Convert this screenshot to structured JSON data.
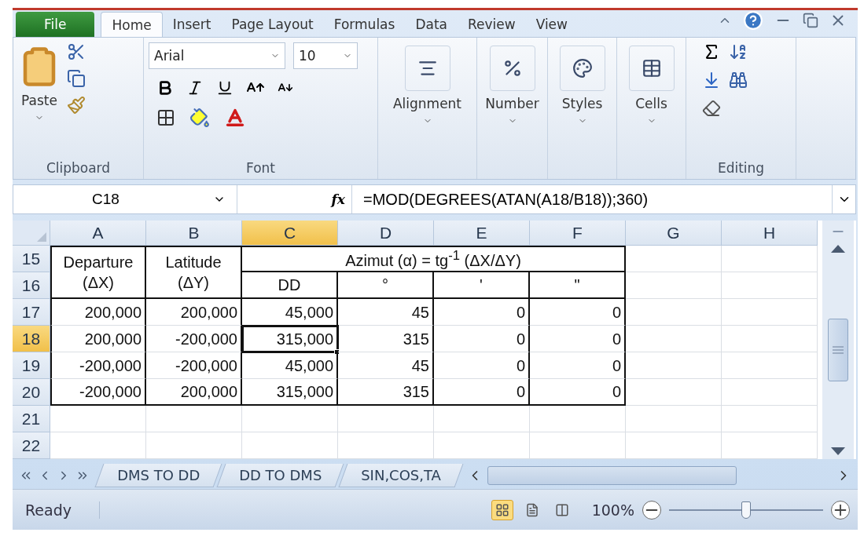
{
  "ribbon_tabs": [
    {
      "label": "File",
      "kind": "file",
      "selected": false
    },
    {
      "label": "Home",
      "kind": "tab",
      "selected": true
    },
    {
      "label": "Insert",
      "kind": "tab",
      "selected": false
    },
    {
      "label": "Page Layout",
      "kind": "tab",
      "selected": false
    },
    {
      "label": "Formulas",
      "kind": "tab",
      "selected": false
    },
    {
      "label": "Data",
      "kind": "tab",
      "selected": false
    },
    {
      "label": "Review",
      "kind": "tab",
      "selected": false
    },
    {
      "label": "View",
      "kind": "tab",
      "selected": false
    }
  ],
  "ribbon": {
    "paste_label": "Paste",
    "clipboard_label": "Clipboard",
    "font_name": "Arial",
    "font_size": "10",
    "font_label": "Font",
    "alignment_label": "Alignment",
    "number_label": "Number",
    "styles_label": "Styles",
    "cells_label": "Cells",
    "editing_label": "Editing"
  },
  "formula_bar": {
    "name_box": "C18",
    "function_label": "fx",
    "formula": "=MOD(DEGREES(ATAN(A18/B18));360)"
  },
  "sheet": {
    "columns": [
      {
        "label": "A",
        "selected": false
      },
      {
        "label": "B",
        "selected": false
      },
      {
        "label": "C",
        "selected": true
      },
      {
        "label": "D",
        "selected": false
      },
      {
        "label": "E",
        "selected": false
      },
      {
        "label": "F",
        "selected": false
      },
      {
        "label": "G",
        "selected": false
      },
      {
        "label": "H",
        "selected": false
      }
    ],
    "rows": [
      {
        "number": "15",
        "selected": false
      },
      {
        "number": "16",
        "selected": false
      },
      {
        "number": "17",
        "selected": false
      },
      {
        "number": "18",
        "selected": true
      },
      {
        "number": "19",
        "selected": false
      },
      {
        "number": "20",
        "selected": false
      },
      {
        "number": "21",
        "selected": false
      },
      {
        "number": "22",
        "selected": false
      }
    ],
    "header": {
      "departure": "Departure\n(ΔX)",
      "latitude": "Latitude\n(ΔY)",
      "azimuth": "Azimut (α) = tg$^{-1}$ (ΔX/ΔY)",
      "units": [
        "DD",
        "°",
        "'",
        "\""
      ]
    },
    "data": [
      {
        "cells": [
          {
            "text": "200,000",
            "selected": false
          },
          {
            "text": "200,000",
            "selected": false
          },
          {
            "text": "45,000",
            "selected": false
          },
          {
            "text": "45",
            "selected": false
          },
          {
            "text": "0",
            "selected": false
          },
          {
            "text": "0",
            "selected": false
          }
        ]
      },
      {
        "cells": [
          {
            "text": "200,000",
            "selected": false
          },
          {
            "text": "-200,000",
            "selected": false
          },
          {
            "text": "315,000",
            "selected": true
          },
          {
            "text": "315",
            "selected": false
          },
          {
            "text": "0",
            "selected": false
          },
          {
            "text": "0",
            "selected": false
          }
        ]
      },
      {
        "cells": [
          {
            "text": "-200,000",
            "selected": false
          },
          {
            "text": "-200,000",
            "selected": false
          },
          {
            "text": "45,000",
            "selected": false
          },
          {
            "text": "45",
            "selected": false
          },
          {
            "text": "0",
            "selected": false
          },
          {
            "text": "0",
            "selected": false
          }
        ]
      },
      {
        "cells": [
          {
            "text": "-200,000",
            "selected": false
          },
          {
            "text": "200,000",
            "selected": false
          },
          {
            "text": "315,000",
            "selected": false
          },
          {
            "text": "315",
            "selected": false
          },
          {
            "text": "0",
            "selected": false
          },
          {
            "text": "0",
            "selected": false
          }
        ]
      }
    ]
  },
  "sheet_tabs": [
    {
      "label": "DMS TO DD"
    },
    {
      "label": "DD TO DMS"
    },
    {
      "label": "SIN,COS,TA"
    }
  ],
  "status_bar": {
    "status": "Ready",
    "views": [
      {
        "kind": "normal",
        "selected": true
      },
      {
        "kind": "page_layout",
        "selected": false
      },
      {
        "kind": "page_break",
        "selected": false
      }
    ],
    "zoom": "100%",
    "zoom_slider": {
      "level": 0.5
    }
  }
}
